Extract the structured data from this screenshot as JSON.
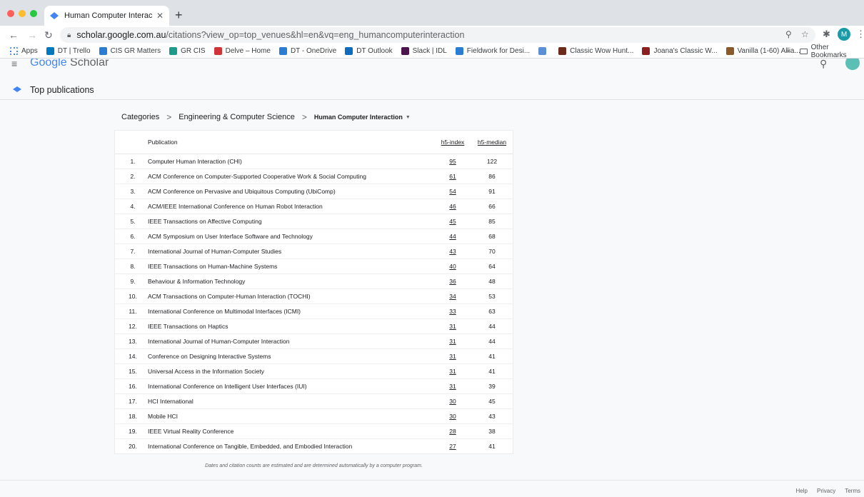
{
  "browser": {
    "tab_title": "Human Computer Interaction -",
    "new_tab": "+",
    "tab_close": "✕",
    "url_host": "scholar.google.com.au",
    "url_rest": "/citations?view_op=top_venues&hl=en&vq=eng_humancomputerinteraction",
    "profile_initial": "M",
    "bookmarks": [
      {
        "label": "Apps",
        "color": "#4285f4"
      },
      {
        "label": "DT | Trello",
        "color": "#0079bf"
      },
      {
        "label": "CIS GR Matters",
        "color": "#2b7cd3"
      },
      {
        "label": "GR CIS",
        "color": "#1c9b8a"
      },
      {
        "label": "Delve – Home",
        "color": "#d13438"
      },
      {
        "label": "DT - OneDrive",
        "color": "#2b7cd3"
      },
      {
        "label": "DT Outlook",
        "color": "#0f6cbd"
      },
      {
        "label": "Slack | IDL",
        "color": "#4a154b"
      },
      {
        "label": "Fieldwork for Desi...",
        "color": "#2b7cd3"
      },
      {
        "label": "",
        "color": "#5c8fd6"
      },
      {
        "label": "Classic Wow Hunt...",
        "color": "#6b2a1a"
      },
      {
        "label": "Joana's Classic W...",
        "color": "#8a1f1f"
      },
      {
        "label": "Vanilla (1-60) Allia...",
        "color": "#8b5a2b"
      }
    ],
    "bookmarks_more": "»",
    "other_bookmarks": "Other Bookmarks"
  },
  "header": {
    "logo_google": "Google",
    "logo_scholar": "Scholar"
  },
  "section": {
    "title": "Top publications"
  },
  "breadcrumb": {
    "items": [
      "Categories",
      "Engineering & Computer Science"
    ],
    "current": "Human Computer Interaction"
  },
  "table": {
    "headers": {
      "publication": "Publication",
      "h5_index": "h5-index",
      "h5_median": "h5-median"
    },
    "rows": [
      {
        "rank": "1.",
        "publication": "Computer Human Interaction (CHI)",
        "h5_index": "95",
        "h5_median": "122"
      },
      {
        "rank": "2.",
        "publication": "ACM Conference on Computer-Supported Cooperative Work & Social Computing",
        "h5_index": "61",
        "h5_median": "86"
      },
      {
        "rank": "3.",
        "publication": "ACM Conference on Pervasive and Ubiquitous Computing (UbiComp)",
        "h5_index": "54",
        "h5_median": "91"
      },
      {
        "rank": "4.",
        "publication": "ACM/IEEE International Conference on Human Robot Interaction",
        "h5_index": "46",
        "h5_median": "66"
      },
      {
        "rank": "5.",
        "publication": "IEEE Transactions on Affective Computing",
        "h5_index": "45",
        "h5_median": "85"
      },
      {
        "rank": "6.",
        "publication": "ACM Symposium on User Interface Software and Technology",
        "h5_index": "44",
        "h5_median": "68"
      },
      {
        "rank": "7.",
        "publication": "International Journal of Human-Computer Studies",
        "h5_index": "43",
        "h5_median": "70"
      },
      {
        "rank": "8.",
        "publication": "IEEE Transactions on Human-Machine Systems",
        "h5_index": "40",
        "h5_median": "64"
      },
      {
        "rank": "9.",
        "publication": "Behaviour & Information Technology",
        "h5_index": "36",
        "h5_median": "48"
      },
      {
        "rank": "10.",
        "publication": "ACM Transactions on Computer-Human Interaction (TOCHI)",
        "h5_index": "34",
        "h5_median": "53"
      },
      {
        "rank": "11.",
        "publication": "International Conference on Multimodal Interfaces (ICMI)",
        "h5_index": "33",
        "h5_median": "63"
      },
      {
        "rank": "12.",
        "publication": "IEEE Transactions on Haptics",
        "h5_index": "31",
        "h5_median": "44"
      },
      {
        "rank": "13.",
        "publication": "International Journal of Human-Computer Interaction",
        "h5_index": "31",
        "h5_median": "44"
      },
      {
        "rank": "14.",
        "publication": "Conference on Designing Interactive Systems",
        "h5_index": "31",
        "h5_median": "41"
      },
      {
        "rank": "15.",
        "publication": "Universal Access in the Information Society",
        "h5_index": "31",
        "h5_median": "41"
      },
      {
        "rank": "16.",
        "publication": "International Conference on Intelligent User Interfaces (IUI)",
        "h5_index": "31",
        "h5_median": "39"
      },
      {
        "rank": "17.",
        "publication": "HCI International",
        "h5_index": "30",
        "h5_median": "45"
      },
      {
        "rank": "18.",
        "publication": "Mobile HCI",
        "h5_index": "30",
        "h5_median": "43"
      },
      {
        "rank": "19.",
        "publication": "IEEE Virtual Reality Conference",
        "h5_index": "28",
        "h5_median": "38"
      },
      {
        "rank": "20.",
        "publication": "International Conference on Tangible, Embedded, and Embodied Interaction",
        "h5_index": "27",
        "h5_median": "41"
      }
    ]
  },
  "disclaimer": "Dates and citation counts are estimated and are determined automatically by a computer program.",
  "footer": {
    "links": [
      "Help",
      "Privacy",
      "Terms"
    ]
  }
}
